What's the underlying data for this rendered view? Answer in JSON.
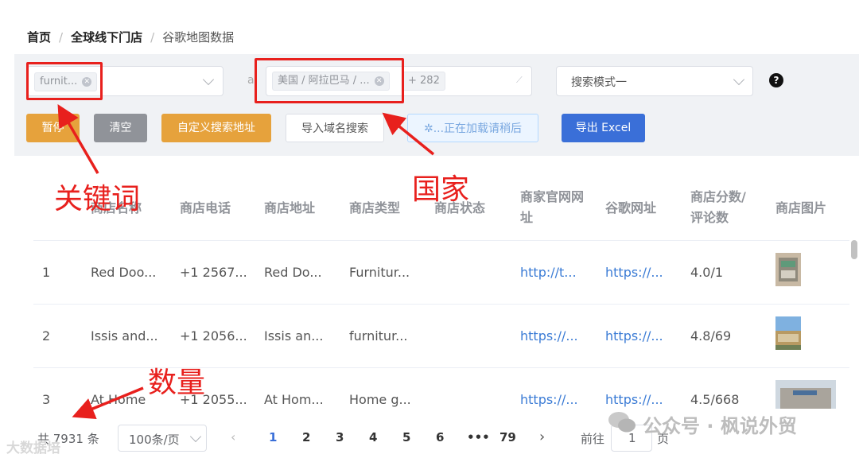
{
  "breadcrumb": {
    "home": "首页",
    "section": "全球线下门店",
    "current": "谷歌地图数据",
    "sep": "/"
  },
  "filters": {
    "keyword_tag": "furnit...",
    "logic_label": "al",
    "country_tag": "美国 / 阿拉巴马 / ...",
    "country_extra": "+ 282",
    "mode_select": "搜索模式一",
    "help_icon": "?"
  },
  "actions": {
    "pause": "暂停",
    "clear": "清空",
    "custom_url": "自定义搜索地址",
    "import_domain": "导入域名搜索",
    "loading": "...正在加载请稍后",
    "export": "导出 Excel"
  },
  "colors": {
    "orange": "#e6a23c",
    "gray": "#909399",
    "blue": "#3a6fd8",
    "red": "#e8201d",
    "link": "#3a7bd5"
  },
  "table": {
    "headers": {
      "name": "商店名称",
      "phone": "商店电话",
      "address": "商店地址",
      "type": "商店类型",
      "status": "商店状态",
      "site_1": "商家官网网",
      "site_2": "址",
      "google": "谷歌网址",
      "score_1": "商店分数/",
      "score_2": "评论数",
      "image": "商店图片"
    },
    "rows": [
      {
        "index": "1",
        "name": "Red Doo...",
        "phone": "+1 2567...",
        "address": "Red Do...",
        "type": "Furnitur...",
        "status": "",
        "website": "http://t...",
        "google": "https://...",
        "score": "4.0/1",
        "image": "store-photo"
      },
      {
        "index": "2",
        "name": "Issis and...",
        "phone": "+1 2056...",
        "address": "Issis an...",
        "type": "furnitur...",
        "status": "",
        "website": "https://...",
        "google": "https://...",
        "score": "4.8/69",
        "image": "store-photo"
      },
      {
        "index": "3",
        "name": "At Home",
        "phone": "+1 2055...",
        "address": "At Hom...",
        "type": "Home g...",
        "status": "",
        "website": "https://...",
        "google": "https://...",
        "score": "4.5/668",
        "image": "store-photo"
      }
    ]
  },
  "pagination": {
    "total": "共 7931 条",
    "page_size": "100条/页",
    "pages": [
      "1",
      "2",
      "3",
      "4",
      "5",
      "6",
      "•••",
      "79"
    ],
    "goto_label": "前往",
    "goto_value": "1",
    "page_unit": "页"
  },
  "annotations": {
    "keyword": "关键词",
    "country": "国家",
    "count": "数量"
  },
  "watermark": {
    "left": "大数据培",
    "right": "公众号 · 枫说外贸"
  }
}
